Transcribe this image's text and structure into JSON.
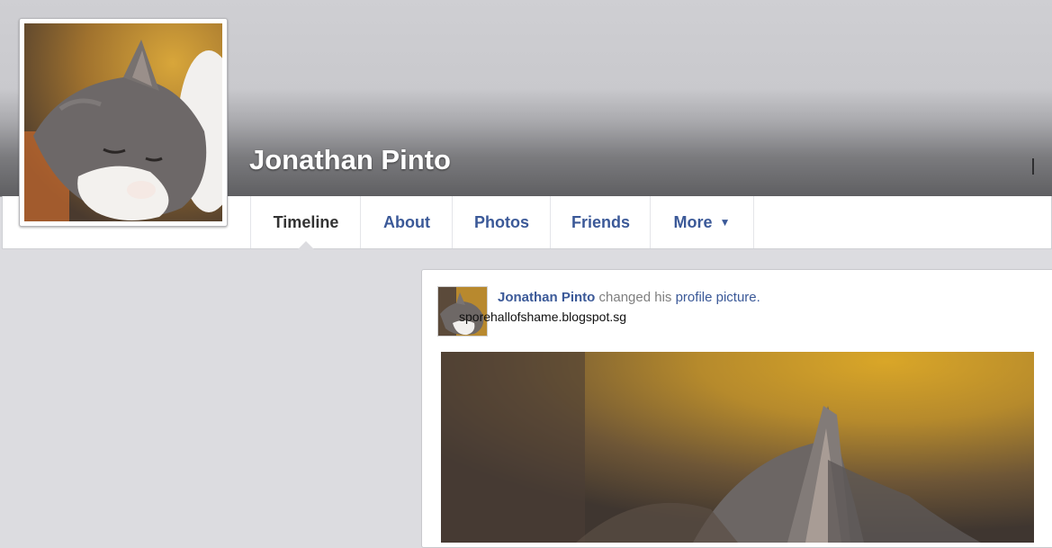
{
  "profile": {
    "name": "Jonathan Pinto"
  },
  "nav": {
    "tabs": [
      {
        "label": "Timeline",
        "active": true
      },
      {
        "label": "About"
      },
      {
        "label": "Photos"
      },
      {
        "label": "Friends"
      },
      {
        "label": "More",
        "icon": "caret-down-icon"
      }
    ]
  },
  "post": {
    "author": "Jonathan Pinto",
    "action": "changed his",
    "object": "profile picture."
  },
  "watermark": "sporehallofshame.blogspot.sg",
  "colors": {
    "link": "#3b5998",
    "page_bg": "#dcdce0",
    "cover_dark": "#5f5f62"
  }
}
